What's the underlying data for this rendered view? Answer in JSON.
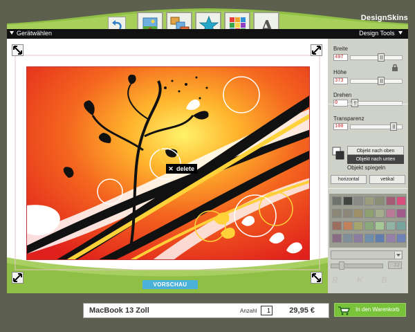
{
  "brand": "DesignSkins",
  "header": {
    "left_label": "Gerätwählen",
    "right_label": "Design Tools"
  },
  "toolbar": {
    "undo": "undo-icon",
    "tools": [
      "image-upload-icon",
      "layouts-icon",
      "star-icon",
      "color-grid-icon",
      "text-icon"
    ]
  },
  "canvas": {
    "delete_label": "delete",
    "preview_label": "VORSCHAU"
  },
  "panel": {
    "width_label": "Breite",
    "width_value": "497",
    "height_label": "Höhe",
    "height_value": "373",
    "rotate_label": "Drehen",
    "rotate_value": "0",
    "transparency_label": "Transparenz",
    "transparency_value": "100",
    "object_up": "Objekt nach oben",
    "object_down": "Objekt nach unten",
    "mirror_label": "Objekt spiegeln",
    "mirror_horizontal": "horizontal",
    "mirror_vertical": "vetikal",
    "color_value": "22",
    "rgb": [
      "R",
      "K",
      "B"
    ]
  },
  "colors": {
    "accent_green": "#8fbf45",
    "preview_blue": "#4bb1d9",
    "cart_green": "#79c33a",
    "swatches": [
      "#6e736b",
      "#404540",
      "#8a8a86",
      "#9c9c7f",
      "#8a8e74",
      "#a45d74",
      "#d84f7e",
      "#8c8876",
      "#8b8678",
      "#9e9167",
      "#8ea06f",
      "#a5ae8c",
      "#ba7b97",
      "#a05b8c",
      "#9c6e5f",
      "#c2805c",
      "#a6a56f",
      "#8ba87a",
      "#a6c896",
      "#93b3a5",
      "#77a49d",
      "#886d84",
      "#7f8f9a",
      "#8c7ea0",
      "#6f8fac",
      "#5f7eaf",
      "#967fa8",
      "#6f82b8"
    ]
  },
  "footer": {
    "product": "MacBook 13 Zoll",
    "qty_label": "Anzahl",
    "qty_value": "1",
    "price": "29,95 €",
    "cart_label": "In den Warenkorb"
  }
}
